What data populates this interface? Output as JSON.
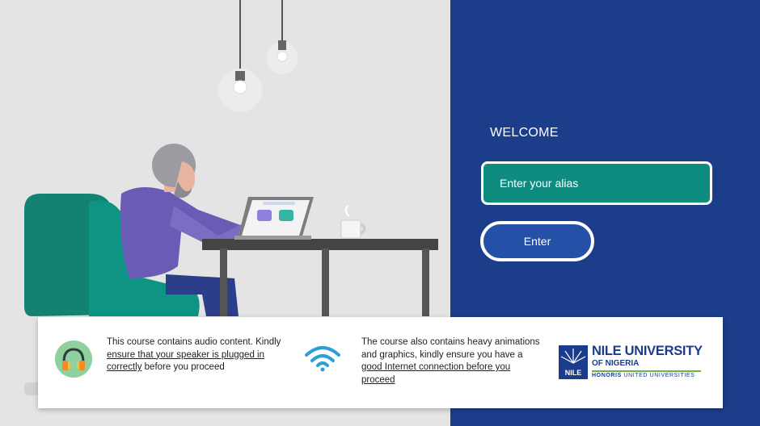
{
  "welcome": {
    "title": "WELCOME"
  },
  "alias": {
    "placeholder": "Enter your alias"
  },
  "enter_button": {
    "label": "Enter"
  },
  "notice_audio": {
    "part1": "This course contains audio content. Kindly ",
    "link": "ensure that your speaker is plugged in correctly",
    "part2": " before you proceed"
  },
  "notice_network": {
    "part1": "The course also contains heavy animations and graphics, kindly ensure you have a ",
    "link": "good Internet connection before you proceed",
    "part2": ""
  },
  "logo": {
    "name": "NILE UNIVERSITY",
    "sub": "OF NIGERIA",
    "emblem_text": "NILE",
    "tagline_bold": "HONORIS",
    "tagline_rest": " UNITED UNIVERSITIES"
  },
  "colors": {
    "panel_blue": "#1c3d8a",
    "input_teal": "#0e8c80",
    "button_blue": "#2450a8",
    "scene_bg": "#e3e4e3"
  },
  "icons": {
    "audio": "headphones-icon",
    "network": "wifi-icon",
    "logo_emblem": "sunburst-emblem-icon"
  }
}
